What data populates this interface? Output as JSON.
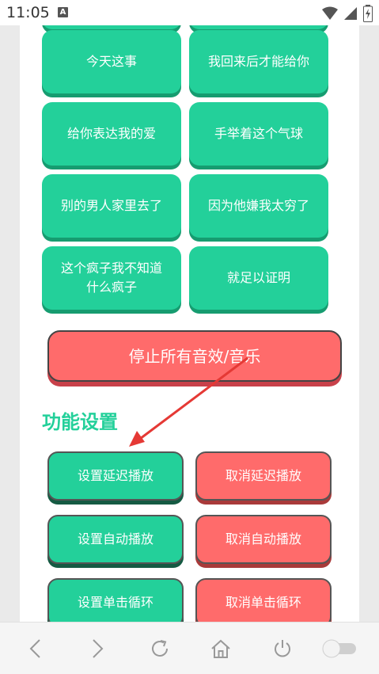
{
  "status": {
    "time": "11:05",
    "notification_glyph": "A"
  },
  "grid_buttons": [
    {
      "label": "今天这事"
    },
    {
      "label": "我回来后才能给你"
    },
    {
      "label": "给你表达我的爱"
    },
    {
      "label": "手举着这个气球"
    },
    {
      "label": "别的男人家里去了"
    },
    {
      "label": "因为他嫌我太穷了"
    },
    {
      "label": "这个疯子我不知道什么疯子",
      "line1": "这个疯子我不知道",
      "line2": "什么疯子"
    },
    {
      "label": "就足以证明"
    }
  ],
  "stop_button": "停止所有音效/音乐",
  "section_title": "功能设置",
  "settings": [
    {
      "set": "设置延迟播放",
      "cancel": "取消延迟播放"
    },
    {
      "set": "设置自动播放",
      "cancel": "取消自动播放"
    },
    {
      "set": "设置单击循环",
      "cancel": "取消单击循环"
    }
  ],
  "colors": {
    "green": "#23d09a",
    "red": "#ff6b6b",
    "arrow": "#e53935"
  },
  "nav_icons": [
    "back-icon",
    "forward-icon",
    "refresh-icon",
    "home-icon",
    "power-icon",
    "toggle-icon"
  ]
}
